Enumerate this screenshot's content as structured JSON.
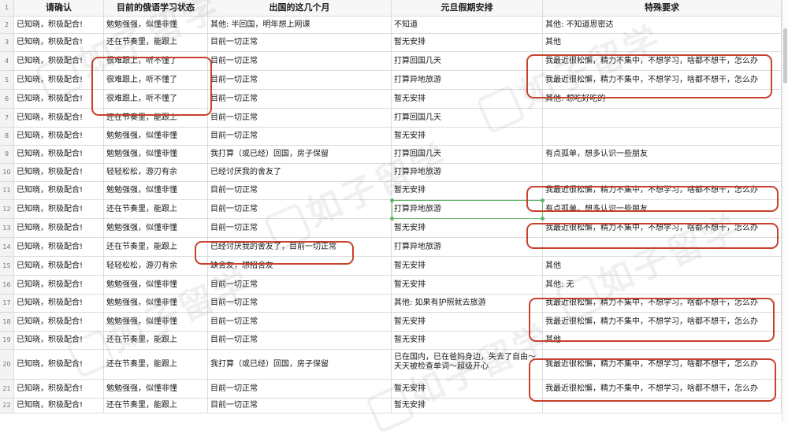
{
  "sheet": {
    "headers": [
      "请确认",
      "目前的俄语学习状态",
      "出国的这几个月",
      "元旦假期安排",
      "特殊要求"
    ],
    "rows": [
      {
        "n": "1",
        "cells": [
          "请确认",
          "目前的俄语学习状态",
          "出国的这几个月",
          "元旦假期安排",
          "特殊要求"
        ]
      },
      {
        "n": "2",
        "cells": [
          "已知晓，积极配合!",
          "勉勉强强，似懂非懂",
          "其他: 半回国，明年想上网课",
          "不知道",
          "其他: 不知道思密达"
        ]
      },
      {
        "n": "3",
        "cells": [
          "已知晓，积极配合!",
          "还在节奏里，能跟上",
          "目前一切正常",
          "暂无安排",
          "其他"
        ]
      },
      {
        "n": "4",
        "cells": [
          "已知晓，积极配合!",
          "很难跟上，听不懂了",
          "目前一切正常",
          "打算回国几天",
          "我最近很松懈，精力不集中，不想学习，啥都不想干，怎么办"
        ]
      },
      {
        "n": "5",
        "cells": [
          "已知晓，积极配合!",
          "很难跟上，听不懂了",
          "目前一切正常",
          "打算异地旅游",
          "我最近很松懈，精力不集中，不想学习，啥都不想干，怎么办"
        ]
      },
      {
        "n": "6",
        "cells": [
          "已知晓，积极配合!",
          "很难跟上，听不懂了",
          "目前一切正常",
          "暂无安排",
          "其他: 想吃好吃的"
        ]
      },
      {
        "n": "7",
        "cells": [
          "已知晓，积极配合!",
          "还在节奏里，能跟上",
          "目前一切正常",
          "打算回国几天",
          ""
        ]
      },
      {
        "n": "8",
        "cells": [
          "已知晓，积极配合!",
          "勉勉强强，似懂非懂",
          "目前一切正常",
          "暂无安排",
          ""
        ]
      },
      {
        "n": "9",
        "cells": [
          "已知晓，积极配合!",
          "勉勉强强，似懂非懂",
          "我打算（或已经）回国，房子保留",
          "打算回国几天",
          "有点孤单，想多认识一些朋友"
        ]
      },
      {
        "n": "10",
        "cells": [
          "已知晓，积极配合!",
          "轻轻松松，游刃有余",
          "已经讨厌我的舍友了",
          "打算异地旅游",
          ""
        ]
      },
      {
        "n": "11",
        "cells": [
          "已知晓，积极配合!",
          "勉勉强强，似懂非懂",
          "目前一切正常",
          "暂无安排",
          "我最近很松懈，精力不集中，不想学习，啥都不想干，怎么办"
        ]
      },
      {
        "n": "12",
        "cells": [
          "已知晓，积极配合!",
          "还在节奏里，能跟上",
          "目前一切正常",
          "打算异地旅游",
          "有点孤单，想多认识一些朋友"
        ]
      },
      {
        "n": "13",
        "cells": [
          "已知晓，积极配合!",
          "勉勉强强，似懂非懂",
          "目前一切正常",
          "暂无安排",
          "我最近很松懈，精力不集中，不想学习，啥都不想干，怎么办"
        ]
      },
      {
        "n": "14",
        "cells": [
          "已知晓，积极配合!",
          "还在节奏里，能跟上",
          "已经讨厌我的舍友了，目前一切正常",
          "打算异地旅游",
          ""
        ]
      },
      {
        "n": "15",
        "cells": [
          "已知晓，积极配合!",
          "轻轻松松，游刃有余",
          "缺舍友，想招舍友",
          "暂无安排",
          "其他"
        ]
      },
      {
        "n": "16",
        "cells": [
          "已知晓，积极配合!",
          "勉勉强强，似懂非懂",
          "目前一切正常",
          "暂无安排",
          "其他: 无"
        ]
      },
      {
        "n": "17",
        "cells": [
          "已知晓，积极配合!",
          "勉勉强强，似懂非懂",
          "目前一切正常",
          "其他: 如果有护照就去旅游",
          "我最近很松懈，精力不集中，不想学习，啥都不想干，怎么办"
        ]
      },
      {
        "n": "18",
        "cells": [
          "已知晓，积极配合!",
          "勉勉强强，似懂非懂",
          "目前一切正常",
          "暂无安排",
          "我最近很松懈，精力不集中，不想学习，啥都不想干，怎么办"
        ]
      },
      {
        "n": "19",
        "cells": [
          "已知晓，积极配合!",
          "还在节奏里，能跟上",
          "目前一切正常",
          "暂无安排",
          "其他"
        ]
      },
      {
        "n": "20",
        "cells": [
          "已知晓，积极配合!",
          "还在节奏里，能跟上",
          "我打算（或已经）回国，房子保留",
          "已在国内，已在爸妈身边，失去了自由～天天被检查单词～超级开心",
          "我最近很松懈，精力不集中，不想学习，啥都不想干，怎么办"
        ]
      },
      {
        "n": "21",
        "cells": [
          "已知晓，积极配合!",
          "勉勉强强，似懂非懂",
          "目前一切正常",
          "暂无安排",
          "我最近很松懈，精力不集中，不想学习，啥都不想干，怎么办"
        ]
      },
      {
        "n": "22",
        "cells": [
          "已知晓，积极配合!",
          "还在节奏里，能跟上",
          "目前一切正常",
          "暂无安排",
          ""
        ]
      }
    ]
  },
  "watermark_text": "如子留学",
  "colors": {
    "annotation": "#c8412c",
    "selection": "#62b56a",
    "grid": "#dcdcdc"
  }
}
